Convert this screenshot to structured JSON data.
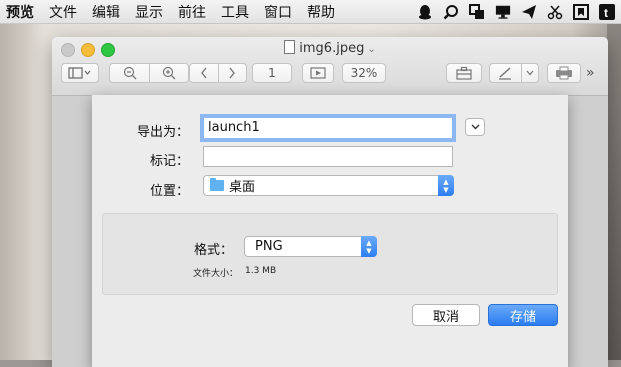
{
  "menubar": {
    "items": [
      "预览",
      "文件",
      "编辑",
      "显示",
      "前往",
      "工具",
      "窗口",
      "帮助"
    ],
    "status_icons": [
      "qq-icon",
      "magnifier-icon",
      "screen-mirror-icon",
      "display-icon",
      "send-icon",
      "scissors-icon",
      "bookmark-box-icon",
      "tumblr-icon"
    ]
  },
  "window": {
    "title": "img6.jpeg",
    "toolbar": {
      "page_number": "1",
      "zoom": "32%"
    }
  },
  "dialog": {
    "export_as_label": "导出为：",
    "export_as_value": "launch1",
    "tags_label": "标记：",
    "tags_value": "",
    "where_label": "位置：",
    "where_value": "桌面",
    "format_label": "格式：",
    "format_value": "PNG",
    "file_size_label": "文件大小：",
    "file_size_value": "1.3 MB",
    "cancel_label": "取消",
    "save_label": "存储"
  },
  "colors": {
    "accent": "#2a7cf0",
    "focus_ring": "#8bb8f0",
    "folder": "#5fb2ef"
  }
}
